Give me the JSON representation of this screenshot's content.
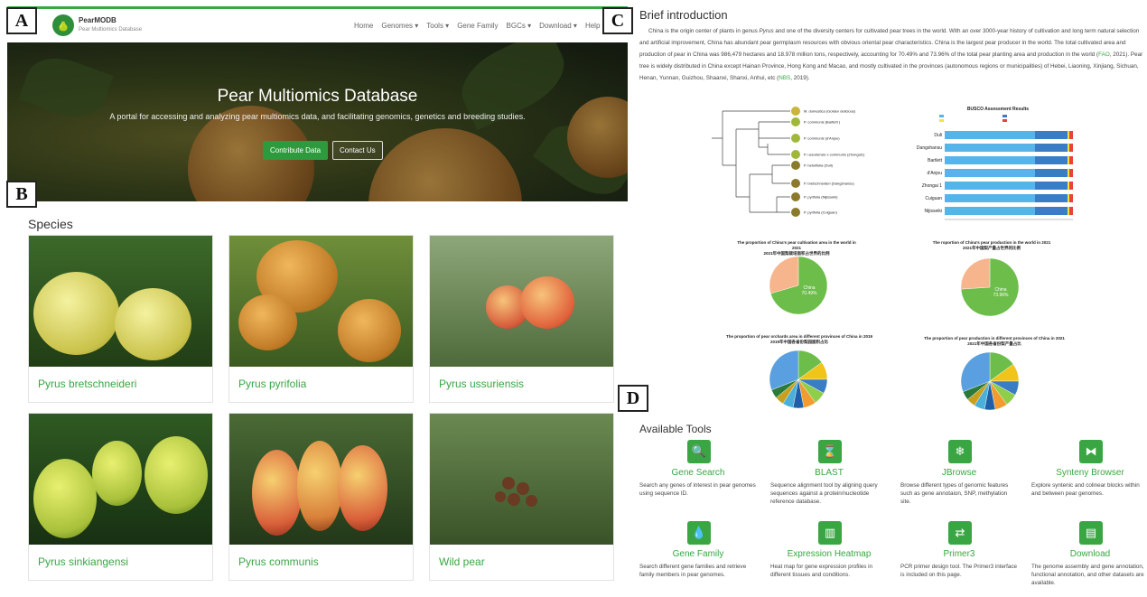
{
  "panels": {
    "a": "A",
    "b": "B",
    "c": "C",
    "d": "D"
  },
  "navbar": {
    "brand_name": "PearMODB",
    "brand_sub": "Pear Multiomics Database",
    "menu": [
      "Home",
      "Genomes ▾",
      "Tools ▾",
      "Gene Family",
      "BGCs ▾",
      "Download ▾",
      "Help ▾"
    ]
  },
  "hero": {
    "title": "Pear Multiomics Database",
    "subtitle": "A portal for accessing and analyzing pear multiomics data, and facilitating genomics, genetics and breeding studies.",
    "btn_primary": "Contribute Data",
    "btn_secondary": "Contact Us"
  },
  "species": {
    "title": "Species",
    "items": [
      {
        "label": "Pyrus bretschneideri"
      },
      {
        "label": "Pyrus pyrifolia"
      },
      {
        "label": "Pyrus ussuriensis"
      },
      {
        "label": "Pyrus sinkiangensi"
      },
      {
        "label": "Pyrus communis"
      },
      {
        "label": "Wild pear"
      }
    ]
  },
  "intro": {
    "title": "Brief introduction",
    "p1": "China is the origin center of plants in genus ",
    "p1_italic": "Pyrus",
    "p2": " and one of the diversity centers for cultivated pear trees in the world. With an over 3000-year history of cultivation and long term natural selection and artificial improvement, China has abundant pear germplasm resources with obvious oriental pear characteristics. China is the largest pear producer in the world. The total cultivated area and production of pear in China was 986,479 hectares and 18.978 million tons, respectively, accounting for 70.49% and 73.96% of the total pear planting area and production in the world (",
    "link1": "FAO",
    "p3": ", 2021). Pear tree is widely distributed in China except Hainan Province, Hong Kong and Macao, and mostly cultivated in the provinces (autonomous regions or municipalities) of Hebei, Liaoning, Xinjiang, Sichuan, Henan, Yunnan, Guizhou, Shaanxi, Shanxi, Anhui, etc (",
    "link2": "NBS",
    "p4": ", 2019)."
  },
  "figures": {
    "tree_taxa": [
      "M. domestica (Golden delicious)",
      "P. communis (Bartlett )",
      "P. communis (d'Anjou)",
      "P. ussuriensis x communis (Zhongai1)",
      "P. betulifolia (Duli)",
      "P. bretschneideri (Dangshansu)",
      "P. pyrifolia (Nijisseiki)",
      "P. pyrifolia (Cuiguan)"
    ],
    "busco_title": "BUSCO Assessment Results",
    "busco_labels": [
      "Duli",
      "Dangshansu",
      "Bartlett",
      "d'Anjou",
      "Zhongai 1",
      "Cuiguan",
      "Nijisseiki"
    ],
    "pie1_title": "The proportion of China's pear cultivation area in the world in 2021",
    "pie1_sub": "2021年中国梨栽培面积占世界的比例",
    "pie1_china": "China\n70.49%",
    "pie2_title": "The roportion of China's pear production in the world in 2021",
    "pie2_sub": "2021年中国梨产量占世界的比例",
    "pie2_china": "China\n73.96%",
    "pie3_title": "The proportion of pear orchards area in different provinces of China in 2019",
    "pie3_sub": "2019年中国各省份梨园面积占比",
    "pie4_title": "The proportion of pear production in different provinces of China in 2021",
    "pie4_sub": "2021年中国各省份梨产量占比",
    "colors": {
      "china": "#6cbd4a",
      "other": "#f7b58d"
    }
  },
  "tools": {
    "title": "Available Tools",
    "items": [
      {
        "name": "Gene Search",
        "icon": "search-icon",
        "glyph": "🔍",
        "desc": "Search any genes of interest in pear genomes using sequence ID."
      },
      {
        "name": "BLAST",
        "icon": "hourglass-icon",
        "glyph": "⌛",
        "desc": "Sequence alignment tool by aligning query sequences against a protein/nucleotide reference database."
      },
      {
        "name": "JBrowse",
        "icon": "snowflake-icon",
        "glyph": "❄",
        "desc": "Browse different types of genomic features such as gene annotaion, SNP, methylation site."
      },
      {
        "name": "Synteny Browser",
        "icon": "synteny-icon",
        "glyph": "⧓",
        "desc": "Explore syntenic and colinear blocks within and between pear genomes."
      },
      {
        "name": "Gene Family",
        "icon": "drop-icon",
        "glyph": "💧",
        "desc": "Search different gene families and retrieve family members in pear genomes."
      },
      {
        "name": "Expression Heatmap",
        "icon": "chart-icon",
        "glyph": "▥",
        "desc": "Heat map for gene expression profiles in different tissues and conditions."
      },
      {
        "name": "Primer3",
        "icon": "primer-icon",
        "glyph": "⇄",
        "desc": "PCR primer design tool. The Primer3 interface is included on this page."
      },
      {
        "name": "Download",
        "icon": "file-icon",
        "glyph": "▤",
        "desc": "The genome assembly and gene annotation, functional annotation, and other datasets are available."
      }
    ]
  }
}
